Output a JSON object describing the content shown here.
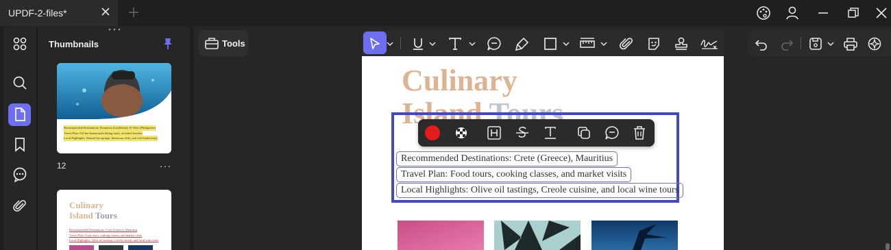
{
  "tab": {
    "title": "UPDF-2-files*"
  },
  "thumbnails_panel": {
    "title": "Thumbnails",
    "page_number": "12",
    "more": "···",
    "page12_lines": [
      "Recommended Destinations: Dominica (Caribbean), El Nido (Philippines)",
      "Travel Plan: Off-the-beaten-path hiking trails, secluded beaches",
      "Local Highlights: Natural hot springs, limestone cliffs, and rich biodiversity"
    ],
    "page13_title_1": "Culinary",
    "page13_title_2a": "Island",
    "page13_title_2b": "Tours",
    "page13_lines": [
      "Recommended Destinations: Crete (Greece), Mauritius",
      "Travel Plan: Food tours, cooking classes, and market visits",
      "Local Highlights: Olive oil tastings, Creole cuisine, and local wine tours"
    ]
  },
  "tools": {
    "label": "Tools"
  },
  "document": {
    "title_line1": "Culinary",
    "title_line2a": "Island",
    "title_line2b": "Tours",
    "lines": [
      "Recommended Destinations: Crete (Greece), Mauritius",
      "Travel Plan: Food tours, cooking classes, and market visits",
      "Local Highlights: Olive oil tastings, Creole cuisine, and local wine tours"
    ]
  },
  "colors": {
    "accent": "#6d6ff0",
    "selection_border": "#4447c9",
    "title_tan": "#ddb493",
    "annotation_red": "#e31b1b"
  },
  "icons": {
    "sidebar": [
      "grid-icon",
      "search-icon",
      "page-icon",
      "bookmark-icon",
      "comment-icon",
      "attachment-icon"
    ],
    "toolbar": [
      "select-icon",
      "underline-icon",
      "text-icon",
      "comment-icon",
      "highlighter-icon",
      "rectangle-icon",
      "ruler-icon",
      "attachment-icon",
      "sticker-icon",
      "stamp-icon",
      "signature-icon"
    ],
    "annotation_bar": [
      "color-swatch",
      "opacity-icon",
      "highlight-icon",
      "strikethrough-icon",
      "underline-text-icon",
      "copy-icon",
      "comment-icon",
      "delete-icon"
    ]
  }
}
